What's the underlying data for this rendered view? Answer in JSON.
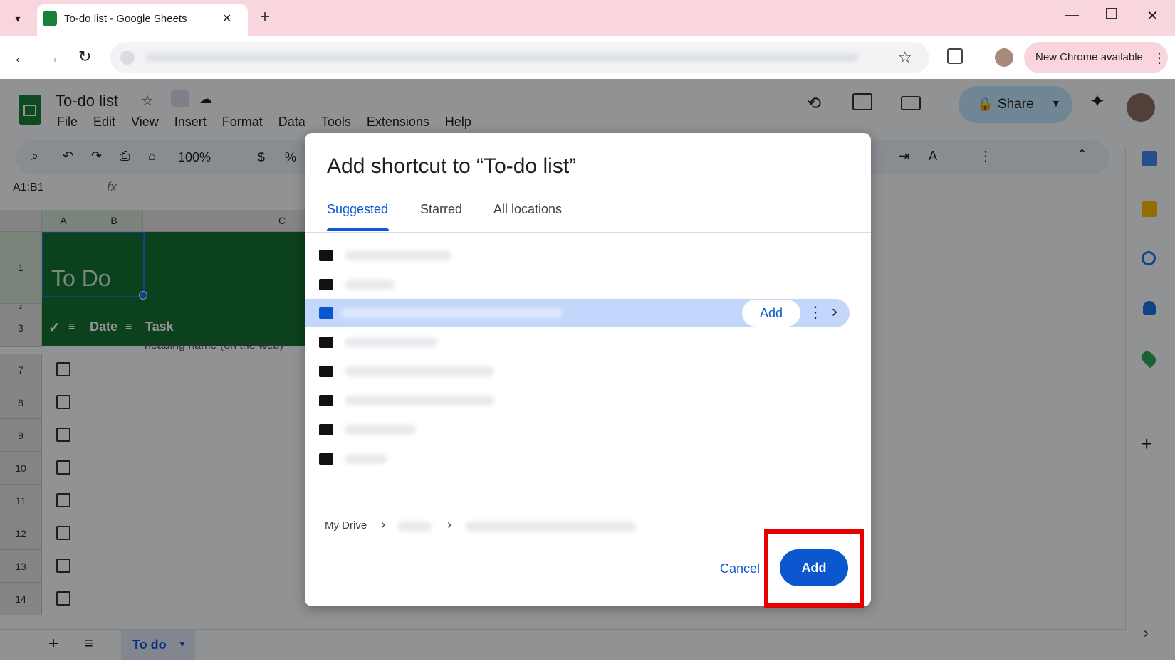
{
  "browser": {
    "tab_title": "To-do list - Google Sheets",
    "new_tab_label": "+",
    "close_label": "✕",
    "new_chrome_label": "New Chrome available"
  },
  "sheets": {
    "doc_title": "To-do list",
    "menu": [
      "File",
      "Edit",
      "View",
      "Insert",
      "Format",
      "Data",
      "Tools",
      "Extensions",
      "Help"
    ],
    "share_label": "Share",
    "zoom": "100%",
    "currency": "$",
    "percent": "%",
    "name_box": "A1:B1",
    "fx": "fx",
    "columns": [
      "A",
      "B",
      "C"
    ],
    "title_cell": "To Do",
    "header_row": {
      "check": "✓",
      "date": "Date",
      "task": "Task"
    },
    "hidden_note": "heading name (on the web)",
    "row_numbers": [
      "1",
      "2",
      "3",
      "7",
      "8",
      "9",
      "10",
      "11",
      "12",
      "13",
      "14"
    ],
    "sheet_tab": "To do"
  },
  "dialog": {
    "title": "Add shortcut to “To-do list”",
    "tabs": [
      "Suggested",
      "Starred",
      "All locations"
    ],
    "active_tab": "Suggested",
    "row_add_label": "Add",
    "breadcrumb_root": "My Drive",
    "cancel_label": "Cancel",
    "add_label": "Add"
  },
  "colors": {
    "accent": "#0b57d0",
    "sheet_green": "#137333",
    "highlight": "#e50000",
    "selected_row": "#c2d7fb"
  }
}
